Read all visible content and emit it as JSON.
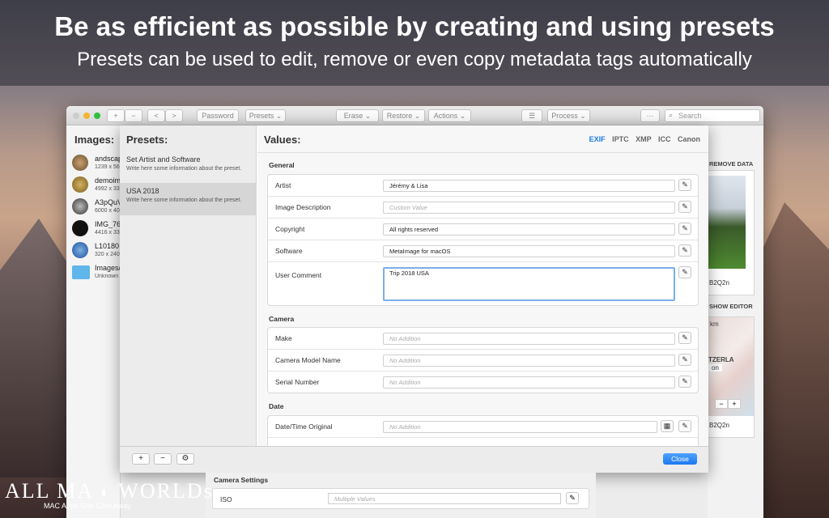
{
  "hero": {
    "title": "Be as efficient as possible by creating and using presets",
    "subtitle": "Presets can be used to edit, remove or even copy metadata tags automatically"
  },
  "toolbar": {
    "add": "+",
    "remove": "−",
    "back": "<",
    "forward": ">",
    "password": "Password",
    "presets": "Presets ⌄",
    "erase": "Erase ⌄",
    "restore": "Restore ⌄",
    "actions": "Actions ⌄",
    "process": "Process ⌄",
    "more": "···",
    "search_placeholder": "Search"
  },
  "images": {
    "header": "Images:",
    "items": [
      {
        "name": "andscap",
        "size": "1239 x 56"
      },
      {
        "name": "demoim",
        "size": "4992 x 33"
      },
      {
        "name": "A3pQuV",
        "size": "6000 x 40"
      },
      {
        "name": "IMG_76",
        "size": "4416 x 33"
      },
      {
        "name": "L10180",
        "size": "320 x 240"
      },
      {
        "name": "Images/",
        "size": "Unknown"
      }
    ]
  },
  "right_panel": {
    "remove_data": "REMOVE DATA",
    "code1": "B2Q2n",
    "show_editor": "SHOW EDITOR",
    "km": "km",
    "switzerland": "TZERLA",
    "on": "on",
    "code2": "B2Q2n",
    "zoom_out": "−",
    "zoom_in": "+"
  },
  "presets": {
    "header": "Presets:",
    "items": [
      {
        "name": "Set Artist and Software",
        "desc": "Write here some information about the preset."
      },
      {
        "name": "USA 2018",
        "desc": "Write here some information about the preset."
      }
    ],
    "selected": 1
  },
  "values": {
    "header": "Values:",
    "tabs": [
      "EXIF",
      "IPTC",
      "XMP",
      "ICC",
      "Canon"
    ],
    "active_tab": "EXIF",
    "general_title": "General",
    "general": [
      {
        "label": "Artist",
        "value": "Jérémy & Lisa",
        "placeholder": false
      },
      {
        "label": "Image Description",
        "value": "Custom Value",
        "placeholder": true
      },
      {
        "label": "Copyright",
        "value": "All rights reserved",
        "placeholder": false
      },
      {
        "label": "Software",
        "value": "MetaImage for macOS",
        "placeholder": false
      }
    ],
    "user_comment": {
      "label": "User Comment",
      "value": "Trip 2018 USA"
    },
    "camera_title": "Camera",
    "camera": [
      {
        "label": "Make",
        "value": "No Addition"
      },
      {
        "label": "Camera Model Name",
        "value": "No Addition"
      },
      {
        "label": "Serial Number",
        "value": "No Addition"
      }
    ],
    "date_title": "Date",
    "date": [
      {
        "label": "Date/Time Original",
        "value": "No Addition"
      }
    ]
  },
  "footer": {
    "add": "+",
    "remove": "−",
    "settings": "⚙",
    "close": "Close"
  },
  "below": {
    "camera_settings": "Camera Settings",
    "iso_label": "ISO",
    "iso_value": "Multiple Values"
  },
  "watermark": {
    "brand_left": "ALL MA",
    "brand_right": "WORLDs",
    "tagline": "MAC Apps One Click Away"
  },
  "colors": {
    "accent": "#1a7ae6",
    "close_button": "#1a78f0"
  }
}
